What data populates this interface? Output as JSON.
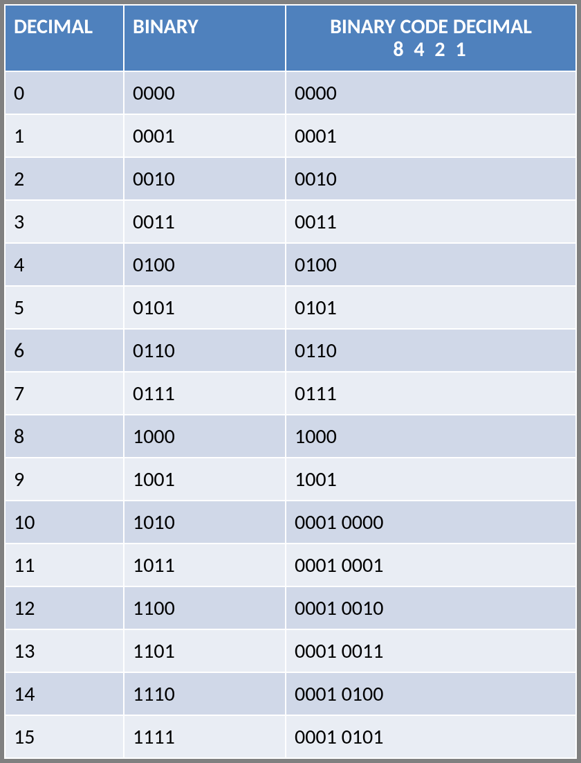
{
  "headers": {
    "decimal": "DECIMAL",
    "binary": "BINARY",
    "bcd_line1": "BINARY CODE DECIMAL",
    "bcd_line2": "8 4 2 1"
  },
  "rows": [
    {
      "decimal": "0",
      "binary": "0000",
      "bcd": "0000"
    },
    {
      "decimal": "1",
      "binary": "0001",
      "bcd": "0001"
    },
    {
      "decimal": "2",
      "binary": "0010",
      "bcd": "0010"
    },
    {
      "decimal": "3",
      "binary": "0011",
      "bcd": "0011"
    },
    {
      "decimal": "4",
      "binary": "0100",
      "bcd": "0100"
    },
    {
      "decimal": "5",
      "binary": "0101",
      "bcd": "0101"
    },
    {
      "decimal": "6",
      "binary": "0110",
      "bcd": "0110"
    },
    {
      "decimal": "7",
      "binary": "0111",
      "bcd": "0111"
    },
    {
      "decimal": "8",
      "binary": "1000",
      "bcd": "1000"
    },
    {
      "decimal": "9",
      "binary": "1001",
      "bcd": "1001"
    },
    {
      "decimal": "10",
      "binary": "1010",
      "bcd": "0001 0000"
    },
    {
      "decimal": "11",
      "binary": "1011",
      "bcd": "0001 0001"
    },
    {
      "decimal": "12",
      "binary": "1100",
      "bcd": "0001 0010"
    },
    {
      "decimal": "13",
      "binary": "1101",
      "bcd": "0001 0011"
    },
    {
      "decimal": "14",
      "binary": "1110",
      "bcd": "0001 0100"
    },
    {
      "decimal": "15",
      "binary": "1111",
      "bcd": "0001 0101"
    }
  ],
  "chart_data": {
    "type": "table",
    "columns": [
      "DECIMAL",
      "BINARY",
      "BINARY CODE DECIMAL 8 4 2 1"
    ],
    "data": [
      [
        "0",
        "0000",
        "0000"
      ],
      [
        "1",
        "0001",
        "0001"
      ],
      [
        "2",
        "0010",
        "0010"
      ],
      [
        "3",
        "0011",
        "0011"
      ],
      [
        "4",
        "0100",
        "0100"
      ],
      [
        "5",
        "0101",
        "0101"
      ],
      [
        "6",
        "0110",
        "0110"
      ],
      [
        "7",
        "0111",
        "0111"
      ],
      [
        "8",
        "1000",
        "1000"
      ],
      [
        "9",
        "1001",
        "1001"
      ],
      [
        "10",
        "1010",
        "0001 0000"
      ],
      [
        "11",
        "1011",
        "0001 0001"
      ],
      [
        "12",
        "1100",
        "0001 0010"
      ],
      [
        "13",
        "1101",
        "0001 0011"
      ],
      [
        "14",
        "1110",
        "0001 0100"
      ],
      [
        "15",
        "1111",
        "0001 0101"
      ]
    ]
  }
}
